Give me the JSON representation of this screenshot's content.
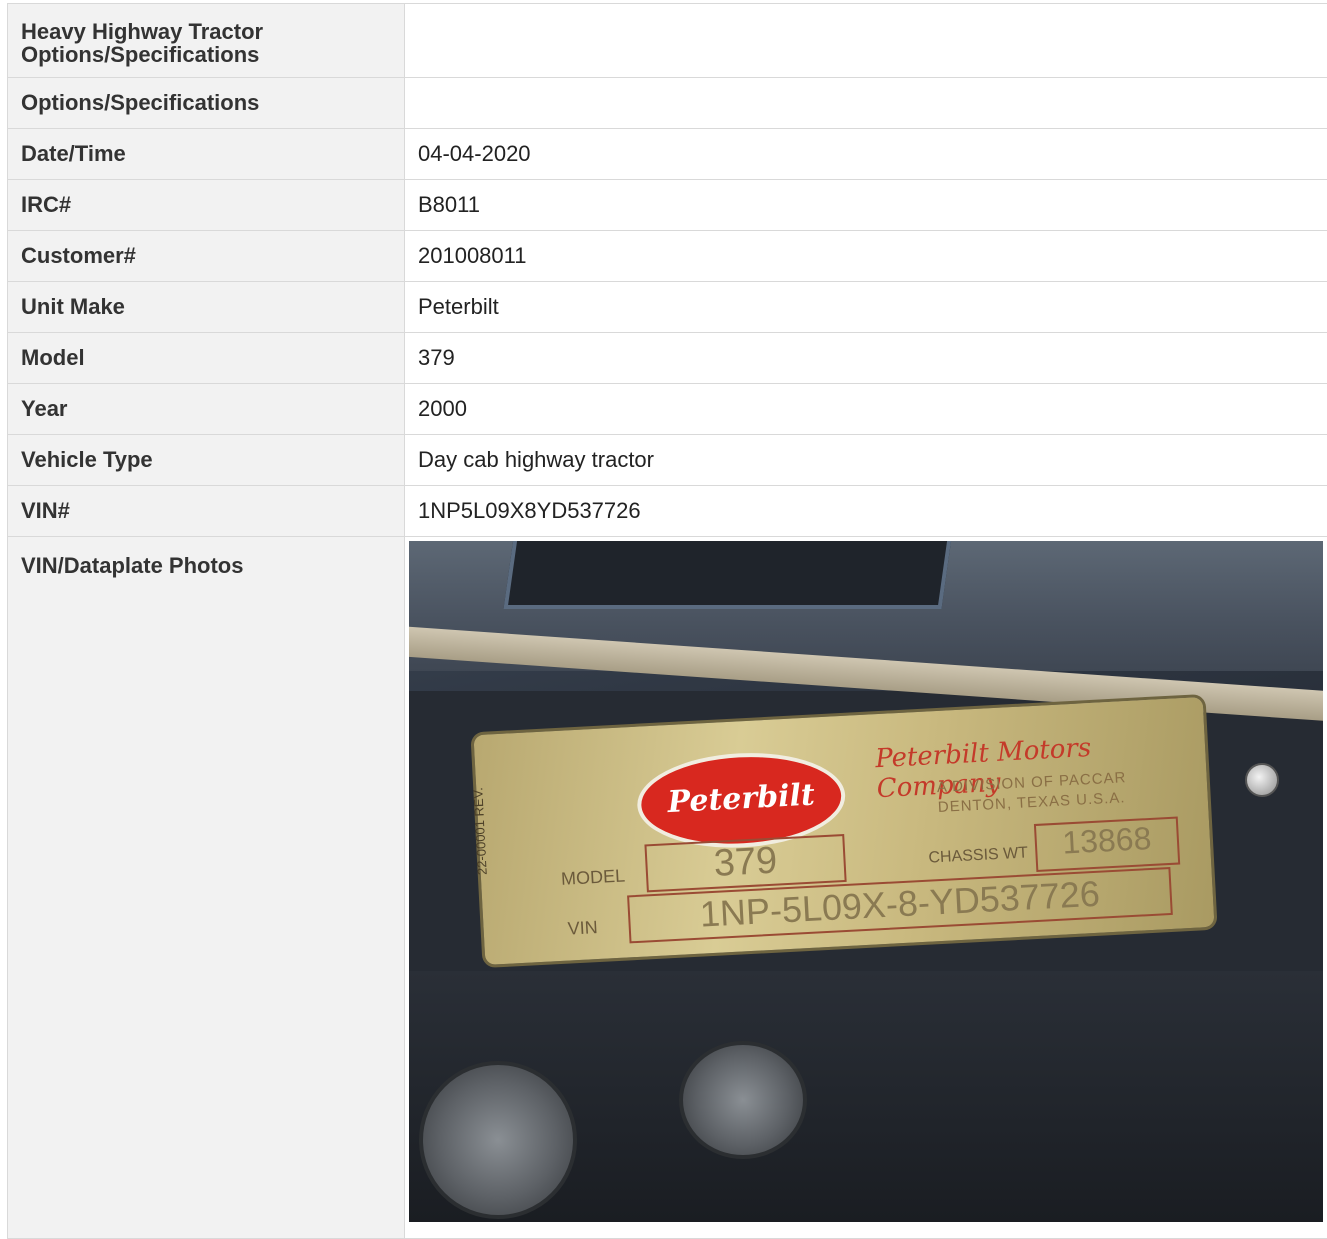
{
  "rows": [
    {
      "label": "Heavy Highway Tractor Options/Specifications",
      "value": ""
    },
    {
      "label": "Options/Specifications",
      "value": ""
    },
    {
      "label": "Date/Time",
      "value": "04-04-2020"
    },
    {
      "label": "IRC#",
      "value": "B8011"
    },
    {
      "label": "Customer#",
      "value": "201008011"
    },
    {
      "label": "Unit Make",
      "value": "Peterbilt"
    },
    {
      "label": "Model",
      "value": "379"
    },
    {
      "label": "Year",
      "value": "2000"
    },
    {
      "label": "Vehicle Type",
      "value": "Day cab highway tractor"
    },
    {
      "label": "VIN#",
      "value": "1NP5L09X8YD537726"
    }
  ],
  "photo_row": {
    "label": "VIN/Dataplate Photos",
    "plate": {
      "logo": "Peterbilt",
      "company": "Peterbilt Motors Company",
      "division": "A DIVISION OF PACCAR",
      "location": "DENTON, TEXAS U.S.A.",
      "model_label": "MODEL",
      "model": "379",
      "chassis_label": "CHASSIS WT",
      "chassis_wt": "13868",
      "vin_label": "VIN",
      "vin": "1NP-5L09X-8-YD537726",
      "rev": "22-00001 REV."
    }
  }
}
